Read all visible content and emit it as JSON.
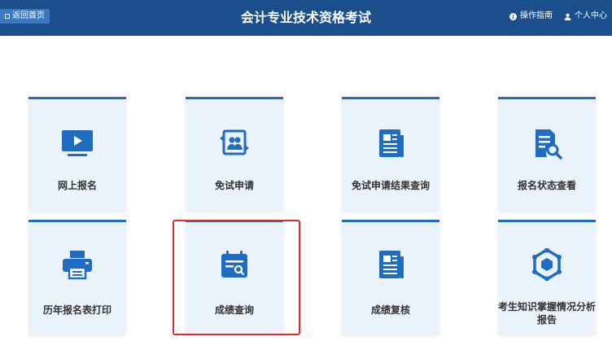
{
  "header": {
    "back_label": "返回首页",
    "title": "会计专业技术资格考试",
    "guide_label": "操作指南",
    "user_label": "个人中心"
  },
  "cards": [
    {
      "label": "网上报名",
      "icon": "monitor-play-icon"
    },
    {
      "label": "免试申请",
      "icon": "user-swap-icon"
    },
    {
      "label": "免试申请结果查询",
      "icon": "document-icon"
    },
    {
      "label": "报名状态查看",
      "icon": "document-search-icon"
    },
    {
      "label": "历年报名表打印",
      "icon": "printer-icon"
    },
    {
      "label": "成绩查询",
      "icon": "calendar-search-icon"
    },
    {
      "label": "成绩复核",
      "icon": "document-icon"
    },
    {
      "label": "考生知识掌握情况分析报告",
      "icon": "hexagon-network-icon"
    }
  ],
  "colors": {
    "header_bg": "#1b4f8b",
    "accent": "#1f6cc1",
    "card_bg": "#eaf2fb",
    "highlight": "#e0292a"
  }
}
